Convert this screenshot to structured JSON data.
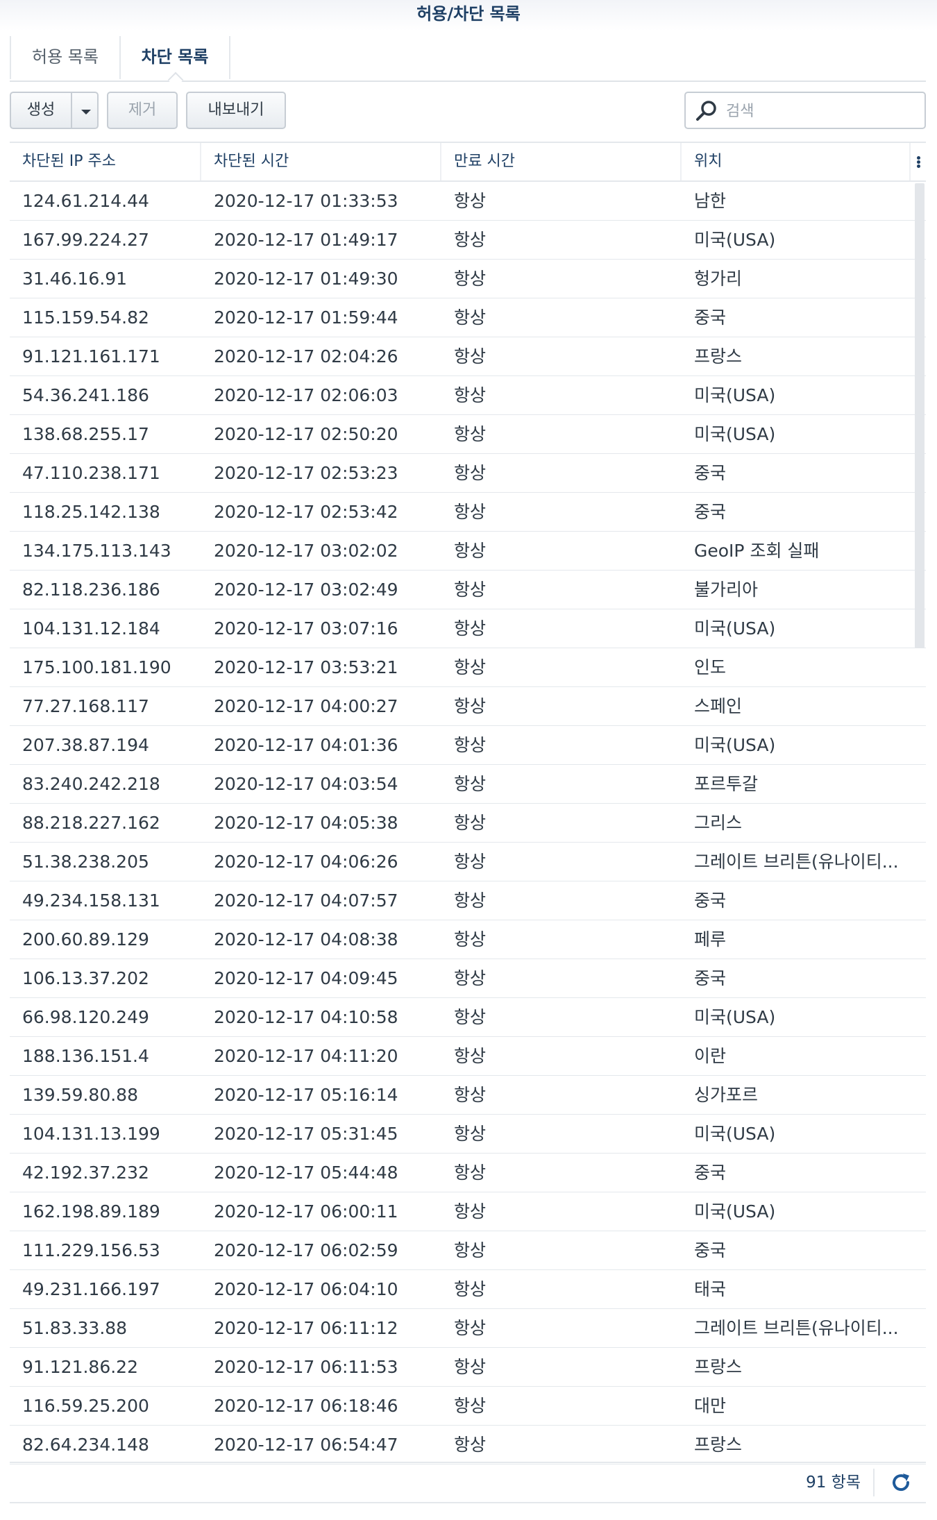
{
  "window": {
    "title": "허용/차단 목록"
  },
  "tabs": [
    {
      "label": "허용 목록",
      "active": false
    },
    {
      "label": "차단 목록",
      "active": true
    }
  ],
  "toolbar": {
    "create_label": "생성",
    "remove_label": "제거",
    "export_label": "내보내기"
  },
  "search": {
    "placeholder": "검색",
    "value": ""
  },
  "columns": [
    "차단된 IP 주소",
    "차단된 시간",
    "만료 시간",
    "위치"
  ],
  "rows": [
    [
      "124.61.214.44",
      "2020-12-17 01:33:53",
      "항상",
      "남한"
    ],
    [
      "167.99.224.27",
      "2020-12-17 01:49:17",
      "항상",
      "미국(USA)"
    ],
    [
      "31.46.16.91",
      "2020-12-17 01:49:30",
      "항상",
      "헝가리"
    ],
    [
      "115.159.54.82",
      "2020-12-17 01:59:44",
      "항상",
      "중국"
    ],
    [
      "91.121.161.171",
      "2020-12-17 02:04:26",
      "항상",
      "프랑스"
    ],
    [
      "54.36.241.186",
      "2020-12-17 02:06:03",
      "항상",
      "미국(USA)"
    ],
    [
      "138.68.255.17",
      "2020-12-17 02:50:20",
      "항상",
      "미국(USA)"
    ],
    [
      "47.110.238.171",
      "2020-12-17 02:53:23",
      "항상",
      "중국"
    ],
    [
      "118.25.142.138",
      "2020-12-17 02:53:42",
      "항상",
      "중국"
    ],
    [
      "134.175.113.143",
      "2020-12-17 03:02:02",
      "항상",
      "GeoIP 조회 실패"
    ],
    [
      "82.118.236.186",
      "2020-12-17 03:02:49",
      "항상",
      "불가리아"
    ],
    [
      "104.131.12.184",
      "2020-12-17 03:07:16",
      "항상",
      "미국(USA)"
    ],
    [
      "175.100.181.190",
      "2020-12-17 03:53:21",
      "항상",
      "인도"
    ],
    [
      "77.27.168.117",
      "2020-12-17 04:00:27",
      "항상",
      "스페인"
    ],
    [
      "207.38.87.194",
      "2020-12-17 04:01:36",
      "항상",
      "미국(USA)"
    ],
    [
      "83.240.242.218",
      "2020-12-17 04:03:54",
      "항상",
      "포르투갈"
    ],
    [
      "88.218.227.162",
      "2020-12-17 04:05:38",
      "항상",
      "그리스"
    ],
    [
      "51.38.238.205",
      "2020-12-17 04:06:26",
      "항상",
      "그레이트 브리튼(유나이티..."
    ],
    [
      "49.234.158.131",
      "2020-12-17 04:07:57",
      "항상",
      "중국"
    ],
    [
      "200.60.89.129",
      "2020-12-17 04:08:38",
      "항상",
      "페루"
    ],
    [
      "106.13.37.202",
      "2020-12-17 04:09:45",
      "항상",
      "중국"
    ],
    [
      "66.98.120.249",
      "2020-12-17 04:10:58",
      "항상",
      "미국(USA)"
    ],
    [
      "188.136.151.4",
      "2020-12-17 04:11:20",
      "항상",
      "이란"
    ],
    [
      "139.59.80.88",
      "2020-12-17 05:16:14",
      "항상",
      "싱가포르"
    ],
    [
      "104.131.13.199",
      "2020-12-17 05:31:45",
      "항상",
      "미국(USA)"
    ],
    [
      "42.192.37.232",
      "2020-12-17 05:44:48",
      "항상",
      "중국"
    ],
    [
      "162.198.89.189",
      "2020-12-17 06:00:11",
      "항상",
      "미국(USA)"
    ],
    [
      "111.229.156.53",
      "2020-12-17 06:02:59",
      "항상",
      "중국"
    ],
    [
      "49.231.166.197",
      "2020-12-17 06:04:10",
      "항상",
      "태국"
    ],
    [
      "51.83.33.88",
      "2020-12-17 06:11:12",
      "항상",
      "그레이트 브리튼(유나이티..."
    ],
    [
      "91.121.86.22",
      "2020-12-17 06:11:53",
      "항상",
      "프랑스"
    ],
    [
      "116.59.25.200",
      "2020-12-17 06:18:46",
      "항상",
      "대만"
    ],
    [
      "82.64.234.148",
      "2020-12-17 06:54:47",
      "항상",
      "프랑스"
    ]
  ],
  "footer": {
    "item_count": "91 항목"
  },
  "icons": {
    "dropdown": "caret-down-icon",
    "search": "search-icon",
    "column_menu": "vertical-dots-icon",
    "refresh": "refresh-icon"
  },
  "colors": {
    "accent": "#1e3f64",
    "text": "#2f3a45",
    "muted": "#9aa3ad",
    "border": "#e4e8ec"
  }
}
